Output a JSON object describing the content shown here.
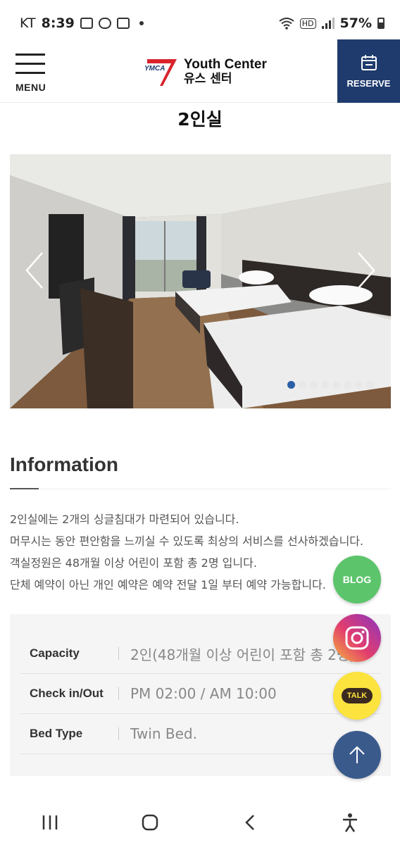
{
  "status_bar": {
    "carrier": "KT",
    "time": "8:39",
    "battery": "57%",
    "hd_label": "HD"
  },
  "header": {
    "menu_label": "MENU",
    "logo_ymca": "YMCA",
    "logo_en": "Youth Center",
    "logo_ko": "유스 센터",
    "reserve_label": "RESERVE"
  },
  "room": {
    "title": "2인실"
  },
  "slider": {
    "total_slides": 8,
    "active_index": 0
  },
  "info": {
    "heading": "Information",
    "lines": [
      "2인실에는 2개의 싱글침대가 마련되어 있습니다.",
      "머무시는 동안 편안함을 느끼실 수 있도록 최상의 서비스를 선사하겠습니다.",
      "객실정원은 48개월 이상 어린이 포함 총 2명 입니다.",
      "단체 예약이 아닌 개인 예약은 예약 전달 1일 부터 예약 가능합니다."
    ]
  },
  "specs": [
    {
      "label": "Capacity",
      "value": "2인(48개월 이상 어린이 포함 총 2명)"
    },
    {
      "label": "Check in/Out",
      "value": "PM 02:00 / AM 10:00"
    },
    {
      "label": "Bed Type",
      "value": "Twin Bed."
    }
  ],
  "floating": {
    "blog_label": "BLOG",
    "kakao_label": "TALK"
  },
  "colors": {
    "brand_navy": "#1f3b6e",
    "ymca_red": "#d9232d",
    "blog_green": "#5cc46b",
    "kakao_yellow": "#fce33e",
    "dot_active": "#2b5fa8"
  }
}
